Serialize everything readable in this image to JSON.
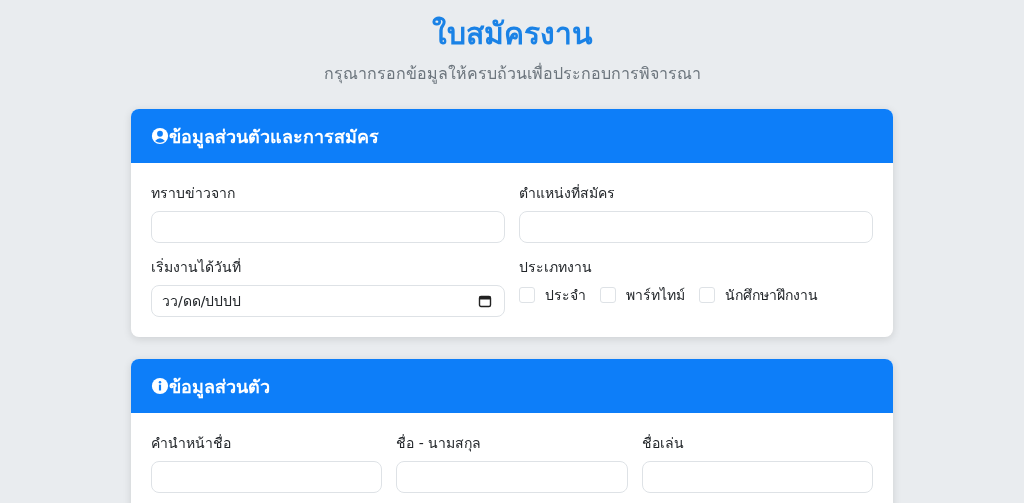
{
  "title": "ใบสมัครงาน",
  "subtitle": "กรุณากรอกข้อมูลให้ครบถ้วนเพื่อประกอบการพิจารณา",
  "sections": [
    {
      "title": "ข้อมูลส่วนตัวและการสมัคร",
      "fields": [
        {
          "kind": "text",
          "label": "ทราบข่าวจาก"
        },
        {
          "kind": "text",
          "label": "ตำแหน่งที่สมัคร"
        },
        {
          "kind": "date",
          "label": "เริ่มงานได้วันที่",
          "placeholder": "วว/ดด/ปปปป"
        },
        {
          "kind": "checkboxes",
          "label": "ประเภทงาน",
          "options": [
            {
              "label": "ประจำ",
              "checked": false
            },
            {
              "label": "พาร์ทไทม์",
              "checked": false
            },
            {
              "label": "นักศึกษาฝึกงาน",
              "checked": false
            }
          ]
        }
      ]
    },
    {
      "title": "ข้อมูลส่วนตัว",
      "fields": [
        {
          "kind": "text",
          "label": "คำนำหน้าชื่อ"
        },
        {
          "kind": "text",
          "label": "ชื่อ - นามสกุล"
        },
        {
          "kind": "text",
          "label": "ชื่อเล่น"
        }
      ]
    }
  ]
}
